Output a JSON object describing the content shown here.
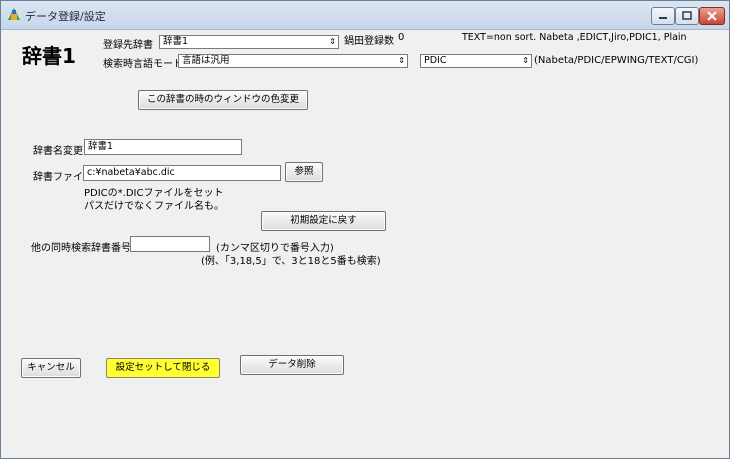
{
  "window": {
    "title": "データ登録/設定"
  },
  "dict_heading": "辞書1",
  "target_dict": {
    "label": "登録先辞書",
    "value": "辞書1"
  },
  "registered_count": {
    "label": "鍋田登録数",
    "value": "0"
  },
  "format_hint": "TEXT=non sort. Nabeta ,EDICT,Jiro,PDIC1, Plain",
  "search_mode": {
    "label": "検索時言語モード",
    "value": "言語は汎用"
  },
  "format_select": {
    "value": "PDIC"
  },
  "format_options_hint": "(Nabeta/PDIC/EPWING/TEXT/CGI)",
  "color_button": "この辞書の時のウィンドウの色変更",
  "dict_name": {
    "label": "辞書名変更",
    "value": "辞書1"
  },
  "dict_file": {
    "label": "辞書ファイル",
    "value": "c:¥nabeta¥abc.dic",
    "browse": "参照"
  },
  "file_note": [
    "PDICの*.DICファイルをセット",
    "パスだけでなくファイル名も。"
  ],
  "reset_button": "初期設定に戻す",
  "concurrent": {
    "label": "他の同時検索辞書番号",
    "value": "",
    "hint": "(カンマ区切りで番号入力)",
    "example": "(例、「3,18,5」で、3と18と5番も検索)"
  },
  "actions": {
    "cancel": "キャンセル",
    "save": "設定セットして閉じる",
    "delete": "データ削除"
  }
}
